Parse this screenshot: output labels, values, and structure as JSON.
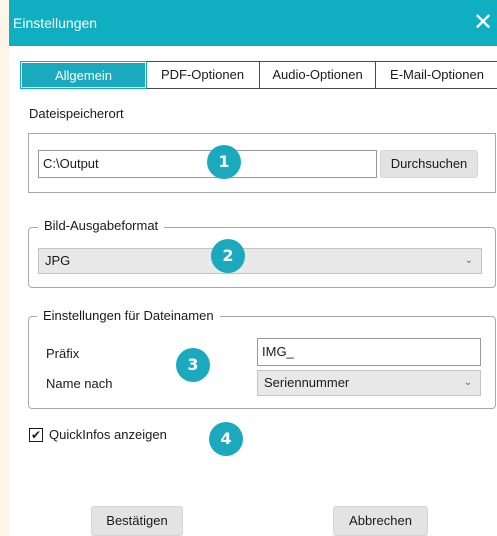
{
  "window": {
    "title": "Einstellungen"
  },
  "tabs": [
    {
      "label": "Allgemein",
      "active": true
    },
    {
      "label": "PDF-Optionen",
      "active": false
    },
    {
      "label": "Audio-Optionen",
      "active": false
    },
    {
      "label": "E-Mail-Optionen",
      "active": false
    }
  ],
  "file_location": {
    "label": "Dateispeicherort",
    "value": "C:\\Output",
    "browse_label": "Durchsuchen"
  },
  "image_format": {
    "legend": "Bild-Ausgabeformat",
    "selected": "JPG"
  },
  "filename_settings": {
    "legend": "Einstellungen für Dateinamen",
    "prefix_label": "Präfix",
    "prefix_value": "IMG_",
    "name_by_label": "Name nach",
    "name_by_selected": "Seriennummer"
  },
  "tooltips": {
    "label": "QuickInfos anzeigen",
    "checked": true
  },
  "footer": {
    "confirm_label": "Bestätigen",
    "cancel_label": "Abbrechen"
  },
  "badges": [
    "1",
    "2",
    "3",
    "4"
  ],
  "colors": {
    "accent": "#1aa9bd",
    "titlebar": "#0fafc1"
  }
}
